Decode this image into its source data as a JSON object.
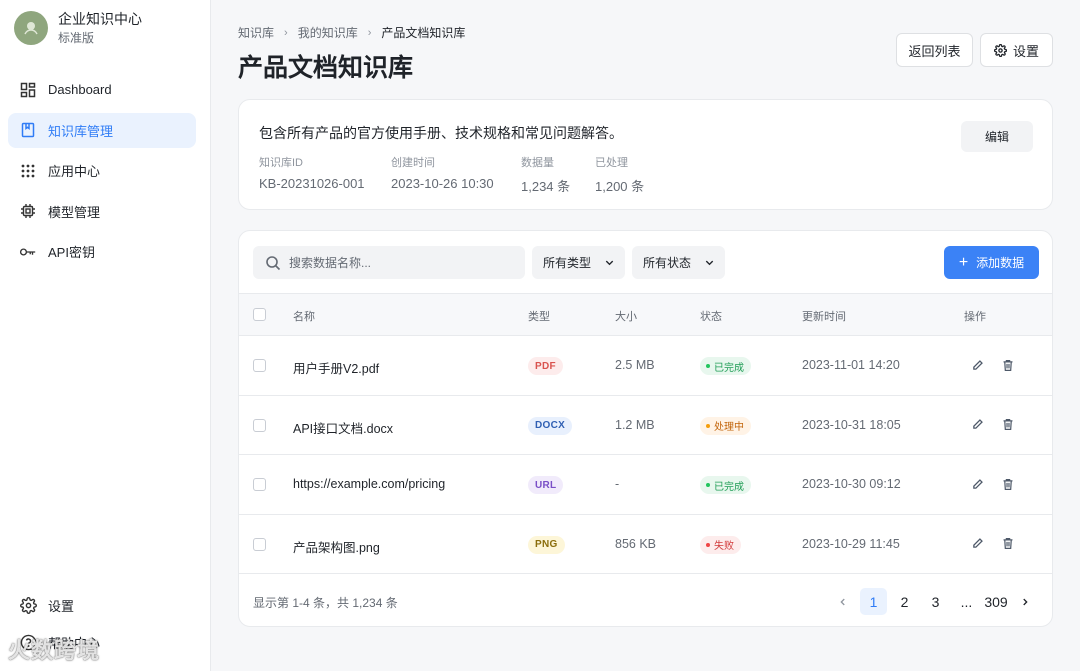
{
  "brand": {
    "name": "企业知识中心",
    "plan": "标准版"
  },
  "nav": [
    {
      "label": "Dashboard",
      "icon": "dashboard-icon",
      "active": false
    },
    {
      "label": "知识库管理",
      "icon": "book-icon",
      "active": true
    },
    {
      "label": "应用中心",
      "icon": "grid-icon",
      "active": false
    },
    {
      "label": "模型管理",
      "icon": "chip-icon",
      "active": false
    },
    {
      "label": "API密钥",
      "icon": "key-icon",
      "active": false
    }
  ],
  "nav_bottom": [
    {
      "label": "设置",
      "icon": "gear-icon"
    },
    {
      "label": "帮助中心",
      "icon": "help-icon"
    }
  ],
  "watermark": "火数跨境",
  "breadcrumb": [
    "知识库",
    "我的知识库",
    "产品文档知识库"
  ],
  "page_title": "产品文档知识库",
  "header_buttons": {
    "back": "返回列表",
    "settings": "设置"
  },
  "info": {
    "description": "包含所有产品的官方使用手册、技术规格和常见问题解答。",
    "edit_label": "编辑",
    "meta": [
      {
        "key": "知识库ID",
        "value": "KB-20231026-001"
      },
      {
        "key": "创建时间",
        "value": "2023-10-26 10:30"
      },
      {
        "key": "数据量",
        "value": "1,234 条"
      },
      {
        "key": "已处理",
        "value": "1,200 条"
      }
    ]
  },
  "toolbar": {
    "search_placeholder": "搜索数据名称...",
    "type_filter": "所有类型",
    "status_filter": "所有状态",
    "add_label": "添加数据"
  },
  "table": {
    "columns": [
      "名称",
      "类型",
      "大小",
      "状态",
      "更新时间",
      "操作"
    ],
    "rows": [
      {
        "name": "用户手册V2.pdf",
        "type": "PDF",
        "size": "2.5 MB",
        "status": "已完成",
        "updated": "2023-11-01 14:20"
      },
      {
        "name": "API接口文档.docx",
        "type": "DOCX",
        "size": "1.2 MB",
        "status": "处理中",
        "updated": "2023-10-31 18:05"
      },
      {
        "name": "https://example.com/pricing",
        "type": "URL",
        "size": "-",
        "status": "已完成",
        "updated": "2023-10-30 09:12"
      },
      {
        "name": "产品架构图.png",
        "type": "PNG",
        "size": "856 KB",
        "status": "失败",
        "updated": "2023-10-29 11:45"
      }
    ]
  },
  "tag_colors": {
    "PDF": {
      "bg": "#fdecec",
      "fg": "#d9534f"
    },
    "DOCX": {
      "bg": "#e8f0fd",
      "fg": "#2f5fb3"
    },
    "URL": {
      "bg": "#f1ebfb",
      "fg": "#7a4fc7"
    },
    "PNG": {
      "bg": "#fdf6d8",
      "fg": "#8a6d0b"
    }
  },
  "status_colors": {
    "已完成": {
      "bg": "#e8f7ee",
      "fg": "#1f9d55",
      "dot": "#22c55e"
    },
    "处理中": {
      "bg": "#fff3e6",
      "fg": "#c2640a",
      "dot": "#f59e0b"
    },
    "失败": {
      "bg": "#fdecec",
      "fg": "#d23b3b",
      "dot": "#ef4444"
    }
  },
  "footer": {
    "summary": "显示第 1-4 条，共 1,234 条",
    "pages": [
      "1",
      "2",
      "3",
      "...",
      "309"
    ],
    "current_page": "1"
  },
  "accent": "#3b82f6"
}
